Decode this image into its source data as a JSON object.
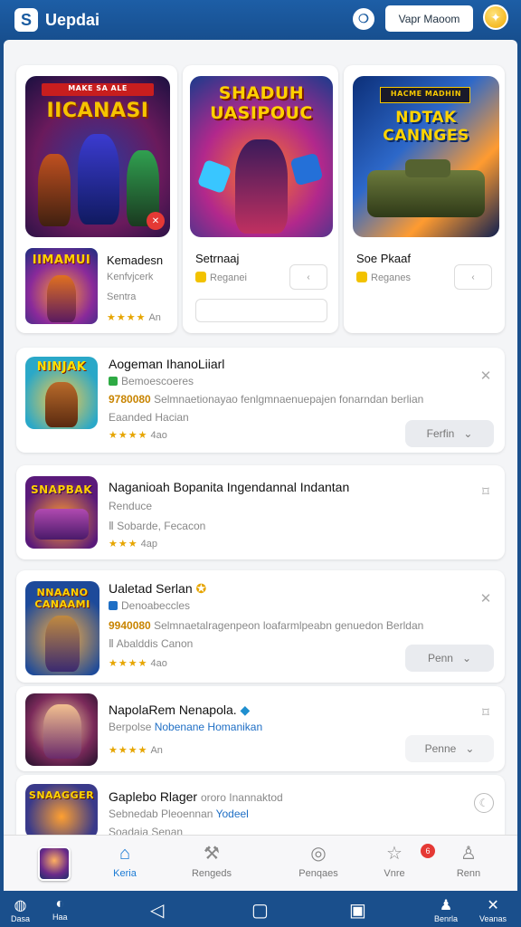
{
  "header": {
    "logo": "S",
    "title": "Uepdai",
    "button_label": "Vapr Maoom",
    "chat_icon": "chat-icon",
    "coin_icon": "coin-icon"
  },
  "featured": [
    {
      "art_title": "IICANASI",
      "art_banner": "MAKE SA ALE",
      "title": "",
      "sub": "",
      "btn": ""
    },
    {
      "art_title": "SHADUH UASIPOUC",
      "title": "Setrnaaj",
      "sub": "Reganei",
      "btn": "‹"
    },
    {
      "art_title": "NDTAK CANNGES",
      "art_banner": "HACME MADHIN",
      "title": "Soe Pkaaf",
      "sub": "Reganes",
      "btn": "‹"
    }
  ],
  "small_card": {
    "art_title": "IIMAMUI",
    "title": "Kemadesn",
    "sub1": "Kenfvjcerk",
    "sub2": "Sentra",
    "stars": "★★★★",
    "rating": "An"
  },
  "list": [
    {
      "art_title": "NINJAK",
      "title": "Aogeman IhanoLiiarl",
      "line1": "Bemoescoeres",
      "highlight": "9780080",
      "line2": "Selmnaetionayao fenlgmnaenuepajen fonarndan berlian",
      "line3": "Eaanded Hacian",
      "stars": "★★★★",
      "rating": "4ao",
      "button": "Ferfin",
      "action_icon": "pin-icon",
      "badge_color": "#2eaa44"
    },
    {
      "art_title": "SNAPBAK",
      "title": "Naganioah Bopanita Ingendannal Indantan",
      "line1": "Renduce",
      "line2": "Ⅱ Sobarde, Fecacon",
      "stars": "★★★",
      "rating": "4ap",
      "action_icon": "bookmark-icon"
    },
    {
      "art_title": "NNAANO CANAAMI",
      "title": "Ualetad Serlan",
      "line1": "Denoabeccles",
      "highlight": "9940080",
      "line2": "Selmnaetalragenpeon loafarmlpeabn genuedon Berldan",
      "line3": "Ⅱ Abalddis Canon",
      "stars": "★★★★",
      "rating": "4ao",
      "button": "Penn",
      "action_icon": "pin-icon",
      "badge_color": "#1f6fc5"
    },
    {
      "art_title": "",
      "title": "NapolaRem Nenapola.",
      "line1": "Berpolse",
      "line1_blue": "Nobenane Homanikan",
      "stars": "★★★★",
      "rating": "An",
      "button": "Penne",
      "action_icon": "bookmark-icon"
    },
    {
      "art_title": "SNAAGGER",
      "title": "Gaplebo Rlager",
      "title_extra": "ororo Inannaktod",
      "line1": "Sebnedab Pleoennan",
      "line1_blue": "Yodeel",
      "line2": "Soadaia Senan",
      "action_icon": "moon-icon"
    }
  ],
  "bottom_nav": [
    {
      "label": "",
      "icon": "avatar"
    },
    {
      "label": "Keria",
      "icon": "home-icon",
      "active": true
    },
    {
      "label": "Rengeds",
      "icon": "hammer-icon"
    },
    {
      "label": "Penqaes",
      "icon": "eye-icon"
    },
    {
      "label": "Vnre",
      "icon": "star-icon",
      "badge": "6"
    },
    {
      "label": "Renn",
      "icon": "person-icon"
    }
  ],
  "system_bar": {
    "left1": "Dasa",
    "left2": "Haa",
    "right1": "Benrla",
    "right2": "Veanas"
  },
  "colors": {
    "header": "#1d5ea6",
    "accent": "#1a7ad4",
    "star": "#e6a500",
    "highlight": "#c88400"
  }
}
